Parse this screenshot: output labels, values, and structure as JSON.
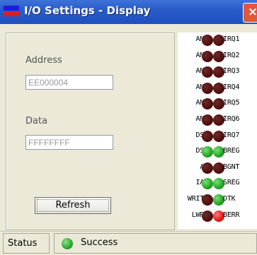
{
  "window": {
    "title": "I/O Settings - Display",
    "close_label": "×"
  },
  "form": {
    "address_label": "Address",
    "address_value": "EE000004",
    "data_label": "Data",
    "data_value": "FFFFFFFF",
    "refresh_label": "Refresh"
  },
  "leds": [
    {
      "left": "AM0",
      "right": "IRQ1",
      "left_state": "dark",
      "right_state": "dark"
    },
    {
      "left": "AM1",
      "right": "IRQ2",
      "left_state": "dark",
      "right_state": "dark"
    },
    {
      "left": "AM2",
      "right": "IRQ3",
      "left_state": "dark",
      "right_state": "dark"
    },
    {
      "left": "AM3",
      "right": "IRQ4",
      "left_state": "dark",
      "right_state": "dark"
    },
    {
      "left": "AM4",
      "right": "IRQ5",
      "left_state": "dark",
      "right_state": "dark"
    },
    {
      "left": "AM5",
      "right": "IRQ6",
      "left_state": "dark",
      "right_state": "dark"
    },
    {
      "left": "DS0",
      "right": "IRQ7",
      "left_state": "dark",
      "right_state": "dark"
    },
    {
      "left": "DS1",
      "right": "BREG",
      "left_state": "green",
      "right_state": "green"
    },
    {
      "left": "AS",
      "right": "BGNT",
      "left_state": "dark",
      "right_state": "dark"
    },
    {
      "left": "IAC",
      "right": "SREG",
      "left_state": "green",
      "right_state": "green"
    },
    {
      "left": "WRITE",
      "right": "DTK",
      "left_state": "dark",
      "right_state": "green"
    },
    {
      "left": "LWRD",
      "right": "BERR",
      "left_state": "dark",
      "right_state": "red"
    }
  ],
  "status": {
    "label": "Status",
    "text": "Success",
    "led_state": "green"
  }
}
